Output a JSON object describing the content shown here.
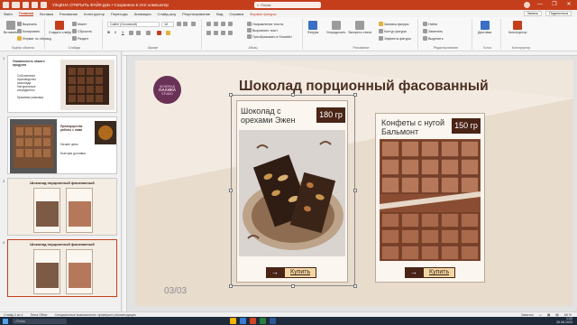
{
  "window": {
    "title": "УЗЦЕНА ОТКРЫТЬ ФАЙЛ.pptx • Сохранено в этот компьютер",
    "search_placeholder": "Поиск",
    "user_initials": "",
    "controls": [
      "—",
      "❐",
      "✕"
    ]
  },
  "ribbon": {
    "tabs": [
      "Файл",
      "Главная",
      "Вставка",
      "Рисование",
      "Конструктор",
      "Переходы",
      "Анимация",
      "Слайд-шоу",
      "Рецензирование",
      "Вид",
      "Справка",
      "Формат фигуры"
    ],
    "active_tab": "Главная",
    "buttons": [
      "Запись",
      "Поделиться"
    ],
    "groups": [
      "Буфер обмена",
      "Слайды",
      "Шрифт",
      "Абзац",
      "Рисование",
      "Редактирование",
      "Голос",
      "Конструктор"
    ],
    "commands": {
      "paste": "Вставить",
      "cut": "Вырезать",
      "copy": "Копировать",
      "format_painter": "Формат по образцу",
      "new_slide": "Создать слайд",
      "layout": "Макет",
      "reset": "Сбросить",
      "section": "Раздел",
      "font_name": "Calibri (Основной)",
      "font_size": "18",
      "text_direction": "Направление текста",
      "align_text": "Выровнять текст",
      "smartart": "Преобразовать в SmartArt",
      "shapes": "Фигуры",
      "arrange": "Упорядочить",
      "quick_styles": "Экспресс-стили",
      "fill": "Заливка фигуры",
      "outline": "Контур фигуры",
      "effects": "Эффекты фигуры",
      "find": "Найти",
      "replace": "Заменить",
      "select": "Выделить",
      "dictate": "Диктовка",
      "designer": "Конструктор"
    }
  },
  "thumbnails": [
    {
      "number": "1",
      "items": [
        "Уникальность нашего продукта",
        "Собственное производство шоколада",
        "Натуральные ингредиенты",
        "Красивая упаковка"
      ]
    },
    {
      "number": "",
      "items": [
        "Преимущества работы с нами",
        "Низкие цены",
        "Быстрая доставка"
      ]
    },
    {
      "number": "3",
      "title": "Шоколад порционный фасованный"
    },
    {
      "number": "4",
      "title": "Шоколад порционный фасованный"
    }
  ],
  "slide": {
    "logo": {
      "line1": "ШОКОЛАД",
      "line2": "ОАХИКА",
      "line3": "STUDIO"
    },
    "title": "Шоколад порционный фасованный",
    "page_number": "03/03",
    "products": [
      {
        "name": "Шоколад с орехами Эжен",
        "weight": "180 гр",
        "button": "Купить",
        "arrow": "→"
      },
      {
        "name": "Конфеты с нугой Бальмонт",
        "weight": "150 гр",
        "button": "Купить",
        "arrow": "→"
      }
    ]
  },
  "statusbar": {
    "slide_info": "Слайд 3 из 4",
    "language": "Tema Office",
    "accessibility": "Специальные возможности: проверьте рекомендации",
    "notes": "Заметки",
    "zoom": "68 %"
  },
  "taskbar": {
    "search": "Поиск",
    "time": "1:22",
    "date": "26.08.2023"
  },
  "colors": {
    "accent": "#c43e1c",
    "title_brown": "#4a2f22",
    "weight_badge": "#4a2416",
    "buy_button": "#f3d7a3",
    "logo": "#6a3157"
  }
}
